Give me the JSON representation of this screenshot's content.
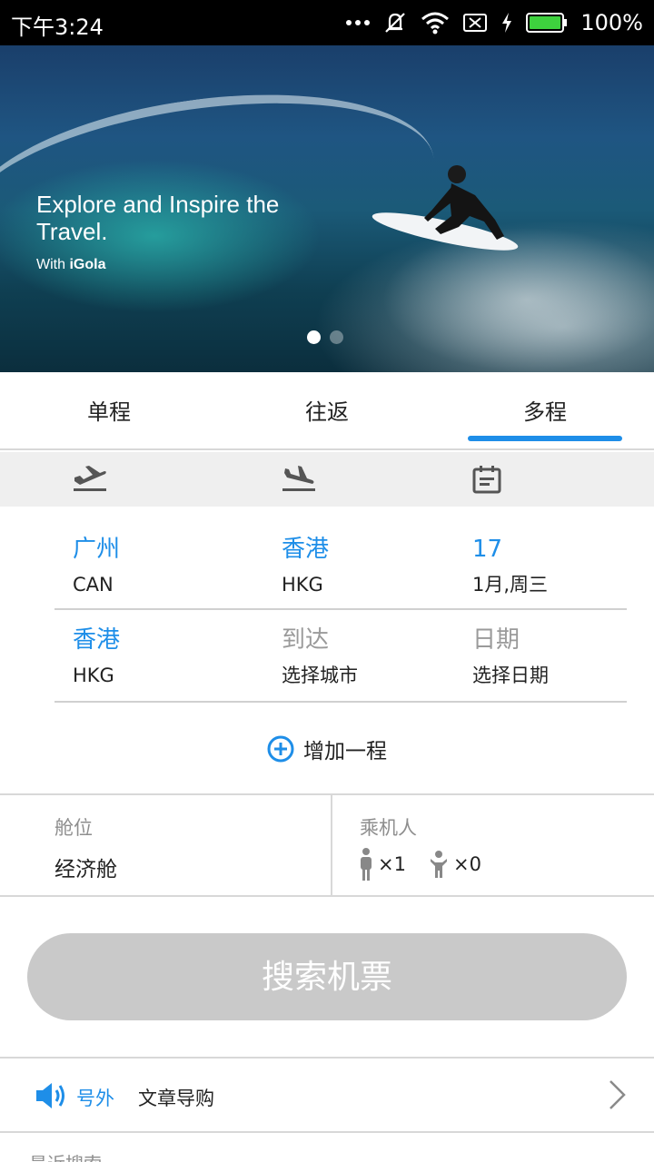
{
  "status_bar": {
    "time": "下午3:24",
    "battery": "100%",
    "icons": [
      "more-dots-icon",
      "mute-vibrate-icon",
      "wifi-icon",
      "no-sim-icon",
      "charging-icon",
      "battery-icon"
    ]
  },
  "banner": {
    "headline": "Explore and Inspire the Travel.",
    "with_prefix": "With",
    "brand": "iGola",
    "slide_count": 2,
    "active_slide": 1
  },
  "tabs": [
    {
      "label": "单程",
      "active": false
    },
    {
      "label": "往返",
      "active": false
    },
    {
      "label": "多程",
      "active": true
    }
  ],
  "column_icons": [
    "departure-icon",
    "arrival-icon",
    "calendar-icon"
  ],
  "legs": [
    {
      "from_city": "广州",
      "from_code": "CAN",
      "to_city": "香港",
      "to_code": "HKG",
      "date_day": "17",
      "date_detail": "1月,周三"
    },
    {
      "from_city": "香港",
      "from_code": "HKG",
      "to_city": "到达",
      "to_code": "选择城市",
      "date_day": "日期",
      "date_detail": "选择日期"
    }
  ],
  "add_leg_label": "增加一程",
  "cabin": {
    "label": "舱位",
    "value": "经济舱"
  },
  "passengers": {
    "label": "乘机人",
    "adults": "×1",
    "children": "×0"
  },
  "search_button": "搜索机票",
  "news": {
    "tag": "号外",
    "text": "文章导购"
  },
  "recent_search_label": "最近搜索",
  "colors": {
    "accent": "#1e8ee8",
    "button_disabled": "#c9c9c9",
    "band": "#efefef"
  }
}
